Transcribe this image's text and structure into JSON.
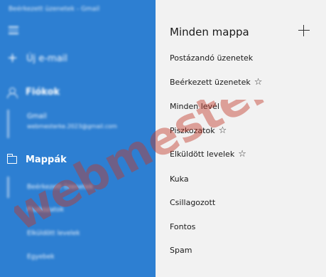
{
  "sidebar": {
    "window_title": "Beérkezett üzenetek - Gmail",
    "new_mail": "Új e-mail",
    "accounts_label": "Fiókok",
    "account": {
      "name": "Gmail",
      "email": "webmesterke.2023@gmail.com"
    },
    "folders_label": "Mappák",
    "folders": [
      "Beérkezett üzenetek",
      "Piszkozatok",
      "Elküldött levelek",
      "Egyebek"
    ]
  },
  "panel": {
    "title": "Minden mappa",
    "items": [
      {
        "label": "Postázandó üzenetek",
        "starred": false
      },
      {
        "label": "Beérkezett üzenetek",
        "starred": true
      },
      {
        "label": "Minden levél",
        "starred": false
      },
      {
        "label": "Piszkozatok",
        "starred": true
      },
      {
        "label": "Elküldött levelek",
        "starred": true
      },
      {
        "label": "Kuka",
        "starred": false
      },
      {
        "label": "Csillagozott",
        "starred": false
      },
      {
        "label": "Fontos",
        "starred": false
      },
      {
        "label": "Spam",
        "starred": false
      }
    ]
  },
  "watermark": {
    "text": "webmesterKE",
    "color": "#c0392b"
  }
}
